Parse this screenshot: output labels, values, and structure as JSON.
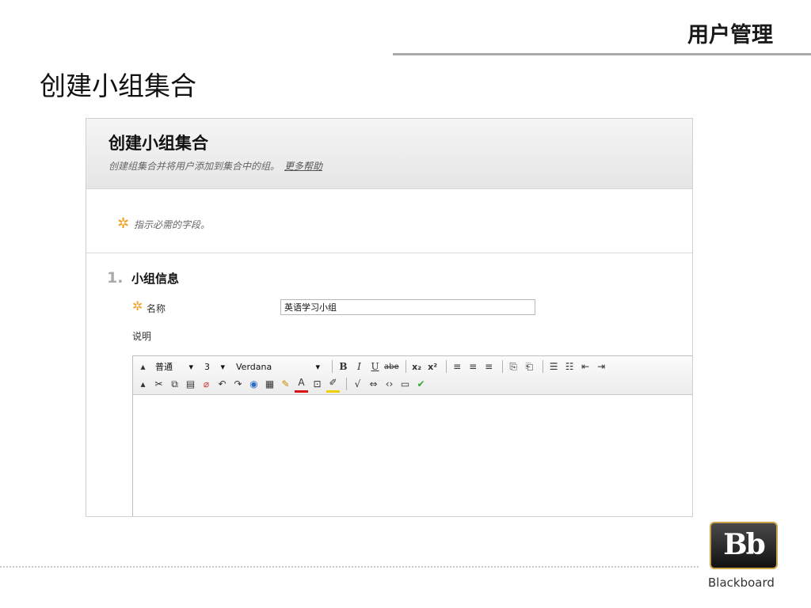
{
  "slide": {
    "header": "用户管理",
    "title": "创建小组集合"
  },
  "panel": {
    "title": "创建小组集合",
    "subtitle": "创建组集合并将用户添加到集合中的组。",
    "help_link": "更多帮助"
  },
  "required_note": {
    "star": "✲",
    "text": "指示必需的字段。"
  },
  "section": {
    "number": "1.",
    "title": "小组信息",
    "name_label": "名称",
    "name_value": "英语学习小组",
    "description_label": "说明"
  },
  "toolbar": {
    "format_value": "普通",
    "size_value": "3",
    "font_value": "Verdana",
    "bold": "B",
    "italic": "I",
    "underline": "U",
    "strike": "abe",
    "sub": "x₂",
    "sup": "x²"
  },
  "branding": {
    "logo_text": "Bb",
    "word": "Blackboard"
  },
  "colors": {
    "required_star": "#f0a020",
    "logo_border": "#caa24a"
  }
}
